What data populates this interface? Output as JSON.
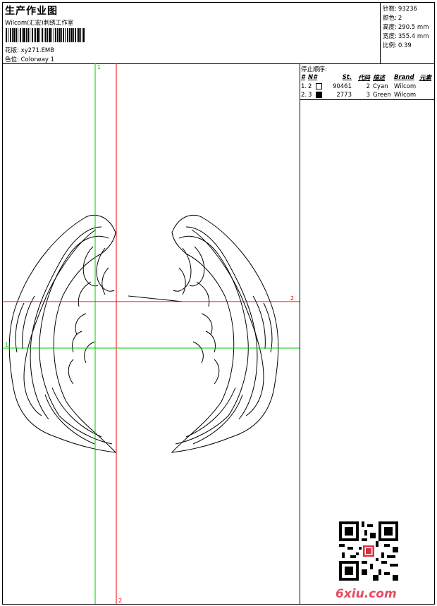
{
  "header": {
    "title": "生产作业图",
    "company": "Wilcom(汇宏)刺绣工作室",
    "design_label": "花版:",
    "design_value": "xy271.EMB",
    "colorway_label": "色位:",
    "colorway_value": "Colorway 1"
  },
  "stats": {
    "stitches_label": "针数:",
    "stitches_value": "93236",
    "colors_label": "颜色:",
    "colors_value": "2",
    "height_label": "高度:",
    "height_value": "290.5 mm",
    "width_label": "宽度:",
    "width_value": "355.4 mm",
    "scale_label": "比例:",
    "scale_value": "0.39"
  },
  "stop_sequence": {
    "title": "停止顺序:",
    "columns": [
      "#",
      "N#",
      "St.",
      "代码",
      "描述",
      "Brand",
      "元素"
    ],
    "rows": [
      {
        "num": "1.",
        "needle": "2",
        "swatch": "#ffffff",
        "stitches": "90461",
        "code": "2",
        "desc": "Cyan",
        "brand": "Wilcom",
        "element": ""
      },
      {
        "num": "2.",
        "needle": "3",
        "swatch": "#000000",
        "stitches": "2773",
        "code": "3",
        "desc": "Green",
        "brand": "Wilcom",
        "element": ""
      }
    ]
  },
  "guides": {
    "vertical_green_label": "1",
    "vertical_red_label": "2",
    "horizontal_red_label": "2",
    "horizontal_green_label": "1",
    "green_color": "#00cc00",
    "red_color": "#ee0000"
  },
  "watermark": {
    "text": "6xiu.com",
    "color": "#e84a5f"
  }
}
